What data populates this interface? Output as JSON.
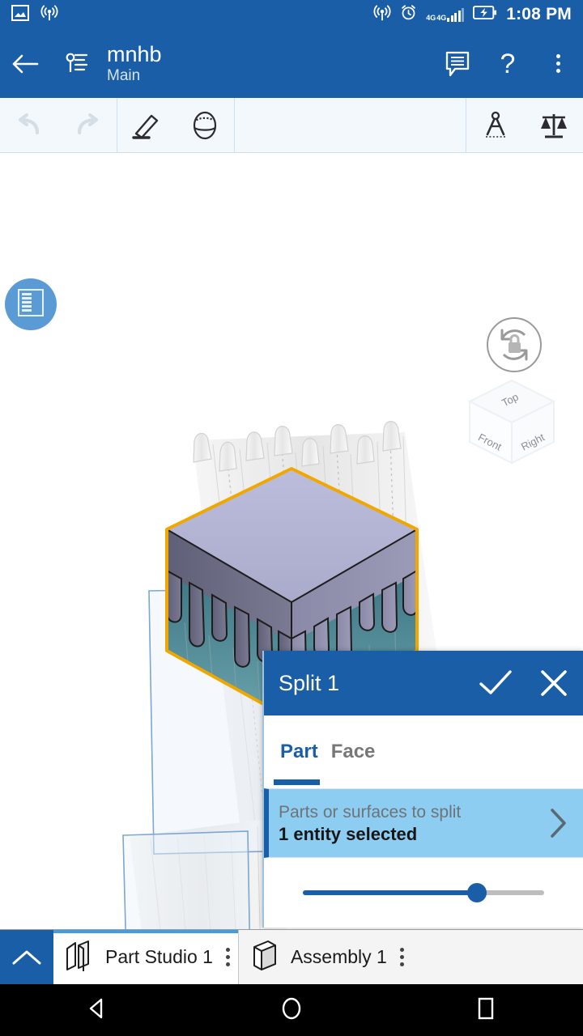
{
  "statusbar": {
    "time": "1:08 PM",
    "left_icons": [
      "screenshot-icon",
      "hotspot-icon"
    ],
    "right_icons": [
      "cast-icon",
      "alarm-icon",
      "signal-4g-icon",
      "signal-4g-icon",
      "battery-charging-icon"
    ],
    "network_label_1": "4G",
    "network_label_2": "4G",
    "bg_color": "#1b5ea8"
  },
  "appbar": {
    "back_label": "back-arrow",
    "branch_label": "branch-icon",
    "title": "mnhb",
    "subtitle": "Main",
    "comments_label": "comments-icon",
    "help_label": "?",
    "overflow_label": "more-options",
    "bg_color": "#1b5ea8"
  },
  "toolbar": {
    "undo_label": "Undo",
    "redo_label": "Redo",
    "sketch_label": "Sketch",
    "shaded_label": "Shaded view",
    "measure_label": "Measure",
    "mass_label": "Mass properties",
    "bg_color": "#f3f8fd",
    "disabled_color": "#d5dde5"
  },
  "viewport": {
    "feature_list_label": "Feature list",
    "fab_color": "#5b9bd5",
    "rotation_lock_label": "Rotation lock",
    "viewcube": {
      "top_label": "Top",
      "front_label": "Front",
      "right_label": "Right"
    },
    "model": {
      "name": "melting-cube",
      "top_face_color": "#b8b8d8",
      "left_face_color": "#6d6d86",
      "right_face_color": "#8f8fae",
      "drip_interior_color": "#4e8794",
      "highlight_outline_color": "#f0a800",
      "ghost_color": "#e8e8e8",
      "sketch_plane_color": "#7ba7d0"
    }
  },
  "dialog": {
    "title": "Split 1",
    "accept_label": "Accept",
    "cancel_label": "Cancel",
    "tabs": [
      {
        "label": "Part",
        "active": true
      },
      {
        "label": "Face",
        "active": false
      }
    ],
    "row": {
      "label": "Parts or surfaces to split",
      "value": "1 entity selected",
      "chevron_label": "chevron-right",
      "highlight_color": "#8ecdf2"
    },
    "slider": {
      "value_percent": 72,
      "fill_color": "#1b5ea8",
      "track_color": "#bdbdbd"
    },
    "header_color": "#1b5ea8"
  },
  "tabbar": {
    "collapse_label": "Collapse",
    "tabs": [
      {
        "label": "Part Studio 1",
        "icon": "part-studio-icon",
        "active": true
      },
      {
        "label": "Assembly 1",
        "icon": "assembly-icon",
        "active": false
      }
    ],
    "active_indicator_color": "#3f9fe0"
  },
  "navbar": {
    "back_label": "Back",
    "home_label": "Home",
    "recents_label": "Recents"
  }
}
